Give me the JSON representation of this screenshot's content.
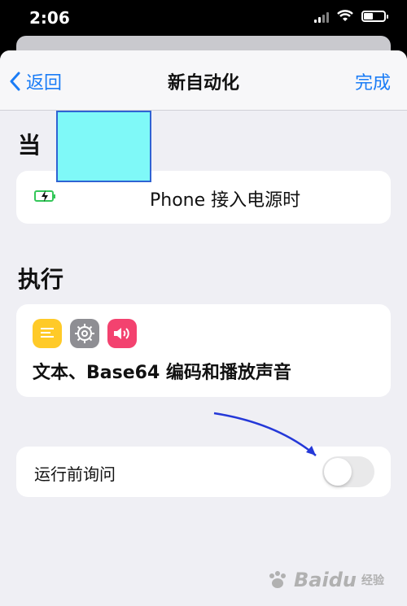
{
  "status_bar": {
    "time": "2:06"
  },
  "nav": {
    "back_label": "返回",
    "title": "新自动化",
    "done_label": "完成"
  },
  "when": {
    "section_title": "当",
    "trigger_text": "Phone 接入电源时"
  },
  "do": {
    "section_title": "执行",
    "icons": [
      "text-icon",
      "settings-icon",
      "sound-icon"
    ],
    "actions_text": "文本、Base64 编码和播放声音"
  },
  "ask": {
    "label": "运行前询问",
    "enabled": false
  },
  "watermark": {
    "brand": "Baidu",
    "sub": "经验"
  },
  "colors": {
    "accent": "#1a7cf6",
    "background": "#efeff4",
    "redaction_fill": "#7ff9f8",
    "annotation_arrow": "#2438d8",
    "sound_icon": "#f3426f",
    "text_icon": "#ffca28",
    "settings_icon": "#8e8e93"
  }
}
